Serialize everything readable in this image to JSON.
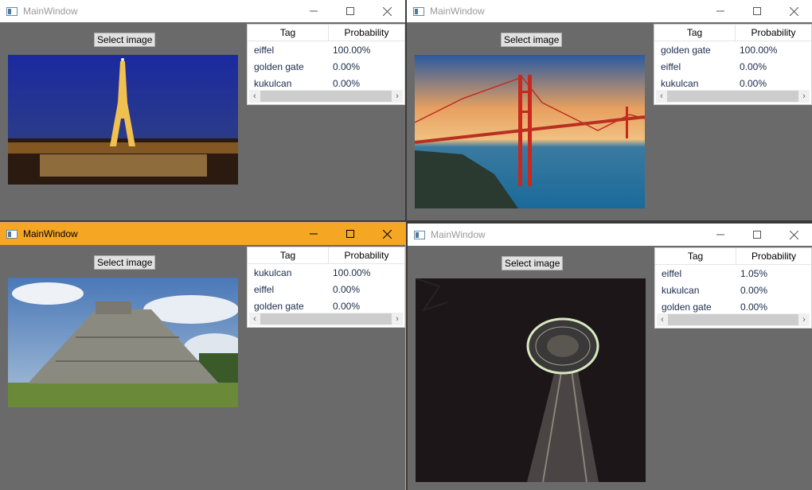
{
  "windows": [
    {
      "title": "MainWindow",
      "button_label": "Select image",
      "headers": {
        "tag": "Tag",
        "probability": "Probability"
      },
      "rows": [
        {
          "tag": "eiffel",
          "prob": "100.00%"
        },
        {
          "tag": "golden gate",
          "prob": "0.00%"
        },
        {
          "tag": "kukulcan",
          "prob": "0.00%"
        }
      ]
    },
    {
      "title": "MainWindow",
      "button_label": "Select image",
      "headers": {
        "tag": "Tag",
        "probability": "Probability"
      },
      "rows": [
        {
          "tag": "golden gate",
          "prob": "100.00%"
        },
        {
          "tag": "eiffel",
          "prob": "0.00%"
        },
        {
          "tag": "kukulcan",
          "prob": "0.00%"
        }
      ]
    },
    {
      "title": "MainWindow",
      "button_label": "Select image",
      "headers": {
        "tag": "Tag",
        "probability": "Probability"
      },
      "rows": [
        {
          "tag": "kukulcan",
          "prob": "100.00%"
        },
        {
          "tag": "eiffel",
          "prob": "0.00%"
        },
        {
          "tag": "golden gate",
          "prob": "0.00%"
        }
      ]
    },
    {
      "title": "MainWindow",
      "button_label": "Select image",
      "headers": {
        "tag": "Tag",
        "probability": "Probability"
      },
      "rows": [
        {
          "tag": "eiffel",
          "prob": "1.05%"
        },
        {
          "tag": "kukulcan",
          "prob": "0.00%"
        },
        {
          "tag": "golden gate",
          "prob": "0.00%"
        }
      ]
    }
  ],
  "colors": {
    "active_titlebar": "#f5a623",
    "client_background": "#6a6a6a"
  },
  "icons": [
    "app-icon",
    "minimize-icon",
    "maximize-icon",
    "close-icon",
    "scroll-left-icon",
    "scroll-right-icon"
  ]
}
